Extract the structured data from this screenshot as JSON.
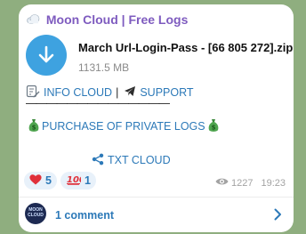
{
  "channel": {
    "title": "Moon Cloud | Free Logs"
  },
  "file": {
    "name": "March Url-Login-Pass - [66 805 272].zip",
    "size": "1131.5 MB"
  },
  "links": {
    "info": "INFO CLOUD",
    "separator": "|",
    "support": "SUPPORT",
    "divider": "——————————————",
    "purchase": "PURCHASE OF PRIVATE LOGS",
    "txt": "TXT CLOUD"
  },
  "reactions": [
    {
      "emoji": "heart",
      "count": "5"
    },
    {
      "emoji": "hundred",
      "count": "1"
    }
  ],
  "meta": {
    "views": "1227",
    "time": "19:23"
  },
  "comments": {
    "label": "1 comment",
    "avatar_text": "MOON CLOUD"
  },
  "colors": {
    "accent": "#2c79b8",
    "title": "#7e5bbf",
    "download": "#3ea2e0",
    "heart": "#e0303a"
  }
}
